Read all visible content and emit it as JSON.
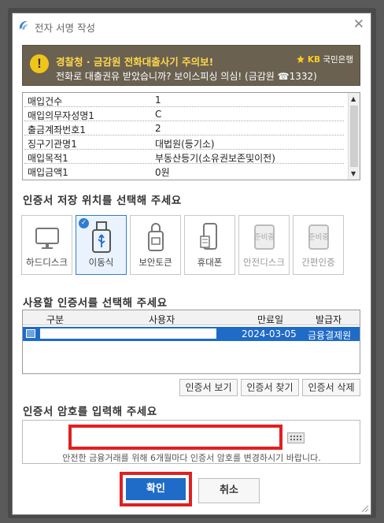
{
  "window": {
    "title": "전자 서명 작성",
    "close_glyph": "✕"
  },
  "banner": {
    "line1": "경찰청 · 금감원 전화대출사기 주의보!",
    "line2": "전화로 대출권유 받았습니까? 보이스피싱 의심! (금감원 ☎1332)",
    "bank_prefix": "KB",
    "bank_name": "국민은행",
    "warn_glyph": "!"
  },
  "info_rows": [
    {
      "key": "매입건수",
      "value": "1"
    },
    {
      "key": "매입의무자성명1",
      "value": "C"
    },
    {
      "key": "출금계좌번호1",
      "value": "2"
    },
    {
      "key": "징구기관명1",
      "value": "대법원(등기소)"
    },
    {
      "key": "매입목적1",
      "value": "부동산등기(소유권보존및이전)"
    },
    {
      "key": "매입금액1",
      "value": "0원"
    }
  ],
  "storage_heading": "인증서 저장 위치를 선택해 주세요",
  "storage_options": [
    {
      "label": "하드디스크",
      "icon": "monitor-icon"
    },
    {
      "label": "이동식",
      "icon": "usb-icon",
      "selected": true
    },
    {
      "label": "보안토큰",
      "icon": "token-icon"
    },
    {
      "label": "휴대폰",
      "icon": "phone-icon"
    },
    {
      "label": "안전디스크",
      "icon": "secure-disk-icon",
      "badge": "준비중"
    },
    {
      "label": "간편인증",
      "icon": "simple-auth-icon",
      "badge": "준비중"
    }
  ],
  "cert_heading": "사용할 인증서를 선택해 주세요",
  "cert_table": {
    "columns": [
      "구분",
      "사용자",
      "만료일",
      "발급자"
    ],
    "rows": [
      {
        "expiry": "2024-03-05",
        "issuer": "금융결제원"
      }
    ]
  },
  "cert_buttons": {
    "view": "인증서 보기",
    "find": "인증서 찾기",
    "delete": "인증서 삭제"
  },
  "password": {
    "heading": "인증서 암호를 입력해 주세요",
    "note": "안전한 금융거래를 위해 6개월마다 인증서 암호를 변경하시기 바랍니다."
  },
  "actions": {
    "ok": "확인",
    "cancel": "취소"
  },
  "colors": {
    "accent": "#1f6bc8",
    "highlight": "#e02020",
    "banner": "#6a6151"
  }
}
